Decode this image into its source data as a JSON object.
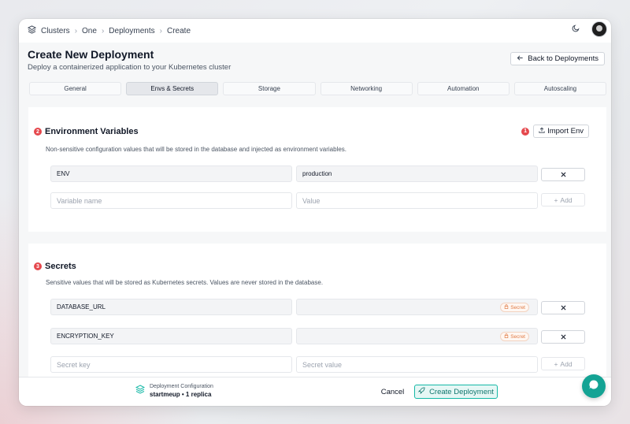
{
  "breadcrumb": {
    "items": [
      "Clusters",
      "One",
      "Deployments",
      "Create"
    ]
  },
  "header": {
    "title": "Create New Deployment",
    "subtitle": "Deploy a containerized application to your Kubernetes cluster",
    "back_label": "Back to Deployments"
  },
  "tabs": [
    {
      "label": "General",
      "active": false
    },
    {
      "label": "Envs & Secrets",
      "active": true
    },
    {
      "label": "Storage",
      "active": false
    },
    {
      "label": "Networking",
      "active": false
    },
    {
      "label": "Automation",
      "active": false
    },
    {
      "label": "Autoscaling",
      "active": false
    }
  ],
  "env": {
    "badge": "2",
    "title": "Environment Variables",
    "description": "Non-sensitive configuration values that will be stored in the database and injected as environment variables.",
    "import_badge": "1",
    "import_label": "Import Env",
    "rows": [
      {
        "name": "ENV",
        "value": "production"
      }
    ],
    "name_placeholder": "Variable name",
    "value_placeholder": "Value",
    "add_label": "Add"
  },
  "secrets": {
    "badge": "3",
    "title": "Secrets",
    "description": "Sensitive values that will be stored as Kubernetes secrets. Values are never stored in the database.",
    "rows": [
      {
        "key": "DATABASE_URL",
        "tag": "Secret"
      },
      {
        "key": "ENCRYPTION_KEY",
        "tag": "Secret"
      }
    ],
    "key_placeholder": "Secret key",
    "value_placeholder": "Secret value",
    "add_label": "Add"
  },
  "footer": {
    "config_label": "Deployment Configuration",
    "config_summary": "startmeup • 1 replica",
    "cancel_label": "Cancel",
    "create_label": "Create Deployment"
  },
  "colors": {
    "accent": "#14b8a6",
    "badge": "#e5484d",
    "secret": "#e07b45"
  }
}
